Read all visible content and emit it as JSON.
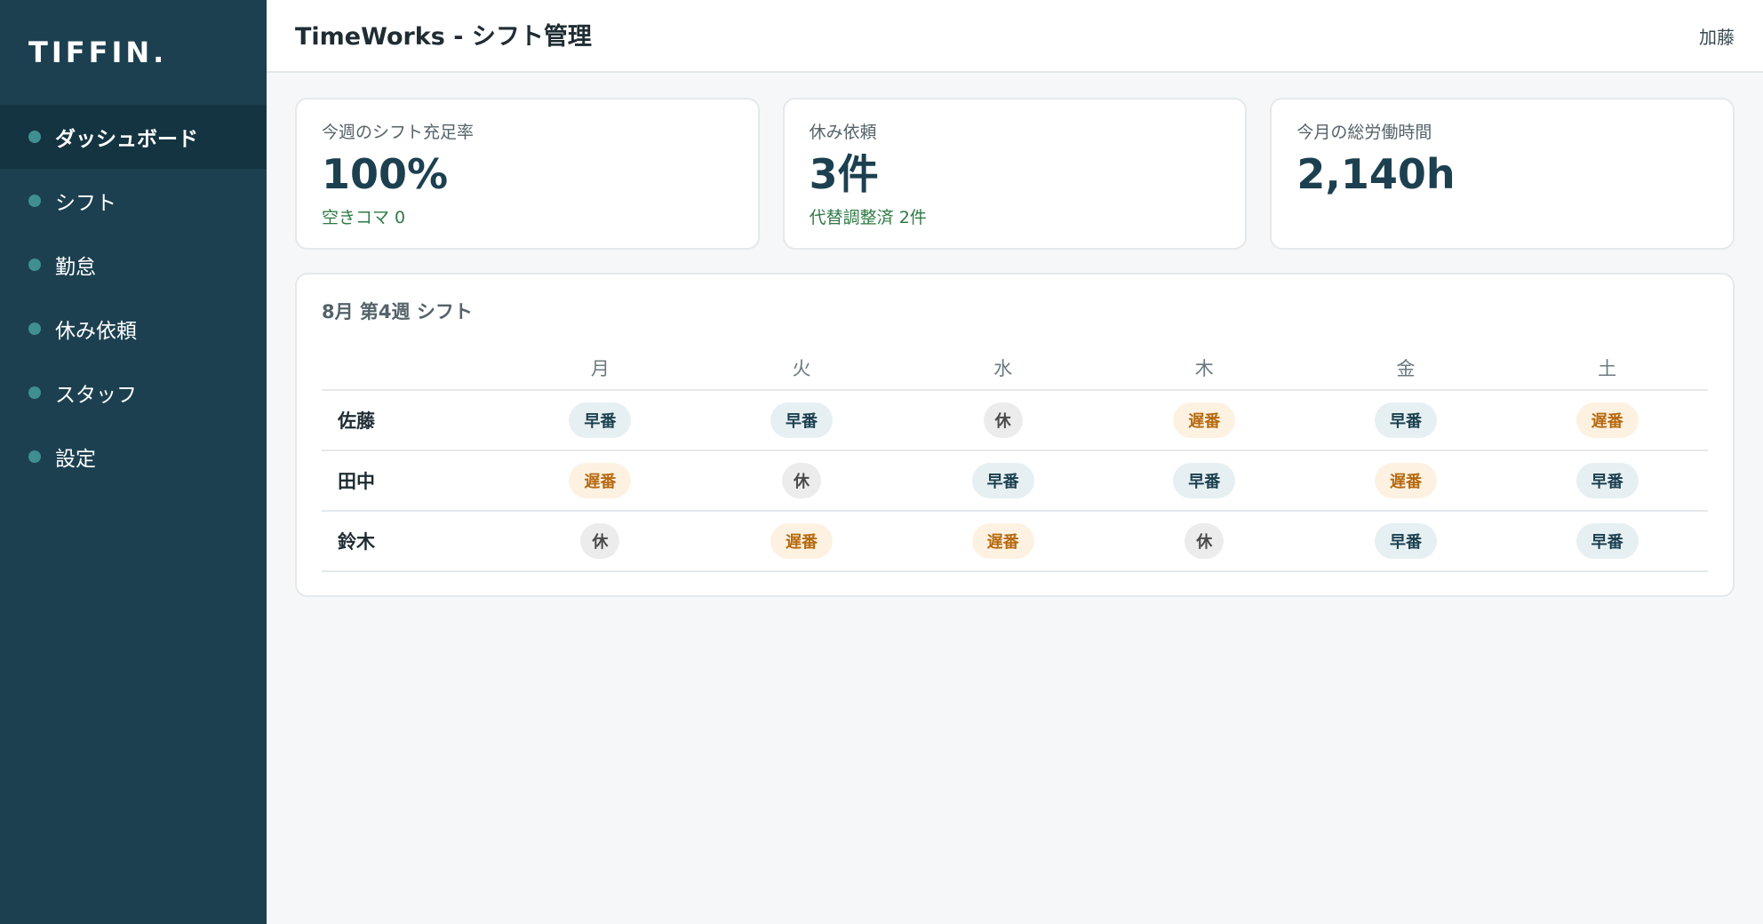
{
  "app": {
    "logo": "TIFFIN.",
    "title": "TimeWorks - シフト管理",
    "user": "加藤"
  },
  "sidebar": {
    "items": [
      {
        "label": "ダッシュボード",
        "active": true
      },
      {
        "label": "シフト",
        "active": false
      },
      {
        "label": "勤怠",
        "active": false
      },
      {
        "label": "休み依頼",
        "active": false
      },
      {
        "label": "スタッフ",
        "active": false
      },
      {
        "label": "設定",
        "active": false
      }
    ]
  },
  "cards": [
    {
      "label": "今週のシフト充足率",
      "value": "100%",
      "sub": "空きコマ 0"
    },
    {
      "label": "休み依頼",
      "value": "3件",
      "sub": "代替調整済 2件"
    },
    {
      "label": "今月の総労働時間",
      "value": "2,140h",
      "sub": ""
    }
  ],
  "schedule": {
    "title": "8月 第4週 シフト",
    "days": [
      "月",
      "火",
      "水",
      "木",
      "金",
      "土"
    ],
    "rows": [
      {
        "name": "佐藤",
        "shifts": [
          "早番",
          "早番",
          "休",
          "遅番",
          "早番",
          "遅番"
        ]
      },
      {
        "name": "田中",
        "shifts": [
          "遅番",
          "休",
          "早番",
          "早番",
          "遅番",
          "早番"
        ]
      },
      {
        "name": "鈴木",
        "shifts": [
          "休",
          "遅番",
          "遅番",
          "休",
          "早番",
          "早番"
        ]
      }
    ]
  },
  "colors": {
    "sidebar": "#1c4050",
    "sidebar_active": "#153441",
    "accent_dot": "#3f8f91",
    "early_bg": "#e6f0f2",
    "late_bg": "#fdf2e2",
    "late_text": "#b66a10",
    "off_bg": "#ececec",
    "positive_text": "#2e7a45"
  }
}
